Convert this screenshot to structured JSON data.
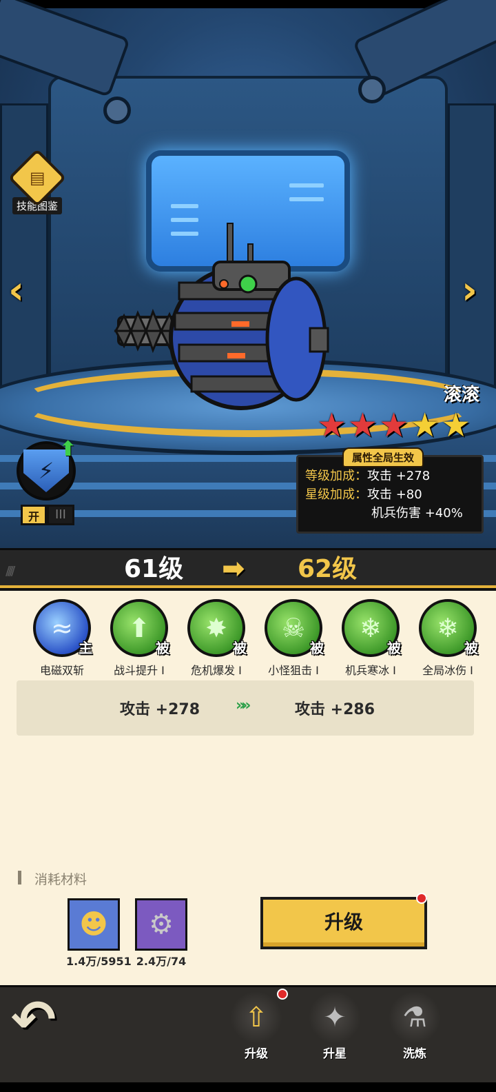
{
  "codex": {
    "label": "技能图鉴"
  },
  "nav": {
    "prev": "‹",
    "next": "›"
  },
  "mech": {
    "name": "滚滚",
    "stars_total": 5,
    "stars_red": 3,
    "stars_gold": 2
  },
  "buff_panel": {
    "tag": "属性全局生效",
    "rows": [
      {
        "key": "等级加成：",
        "value": "攻击 +278"
      },
      {
        "key": "星级加成：",
        "value": "攻击 +80"
      },
      {
        "key": "",
        "value": "机兵伤害 +40%"
      }
    ]
  },
  "core_toggle": {
    "on": "开",
    "off": "III"
  },
  "level": {
    "from": "61级",
    "to": "62级"
  },
  "skills": [
    {
      "name": "电磁双斩",
      "badge": "主",
      "type": "main",
      "icon": "blade-slash-icon"
    },
    {
      "name": "战斗提升 I",
      "badge": "被",
      "type": "passive",
      "icon": "up-arrow-icon"
    },
    {
      "name": "危机爆发 I",
      "badge": "被",
      "type": "passive",
      "icon": "burst-icon"
    },
    {
      "name": "小怪狙击 I",
      "badge": "被",
      "type": "passive",
      "icon": "skull-icon"
    },
    {
      "name": "机兵寒冰 I",
      "badge": "被",
      "type": "passive",
      "icon": "snowflake-icon"
    },
    {
      "name": "全局冰伤 I",
      "badge": "被",
      "type": "passive",
      "icon": "snowflake-icon"
    }
  ],
  "stat_change": {
    "from": "攻击 +278",
    "to": "攻击 +286"
  },
  "materials": {
    "title": "消耗材料",
    "items": [
      {
        "icon": "skull-coin-icon",
        "count": "1.4万/5951"
      },
      {
        "icon": "gear-icon",
        "count": "2.4万/74"
      }
    ]
  },
  "upgrade_button": {
    "label": "升级"
  },
  "bottom_tabs": [
    {
      "label": "升级",
      "icon": "upgrade-arrow-icon",
      "active": true
    },
    {
      "label": "升星",
      "icon": "star-burst-icon",
      "active": false
    },
    {
      "label": "洗炼",
      "icon": "flask-icon",
      "active": false
    }
  ],
  "colors": {
    "accent_gold": "#f2c64a",
    "star_red": "#e23b3b",
    "panel_bg": "#fbf2dc",
    "positive_green": "#2ea04a"
  }
}
